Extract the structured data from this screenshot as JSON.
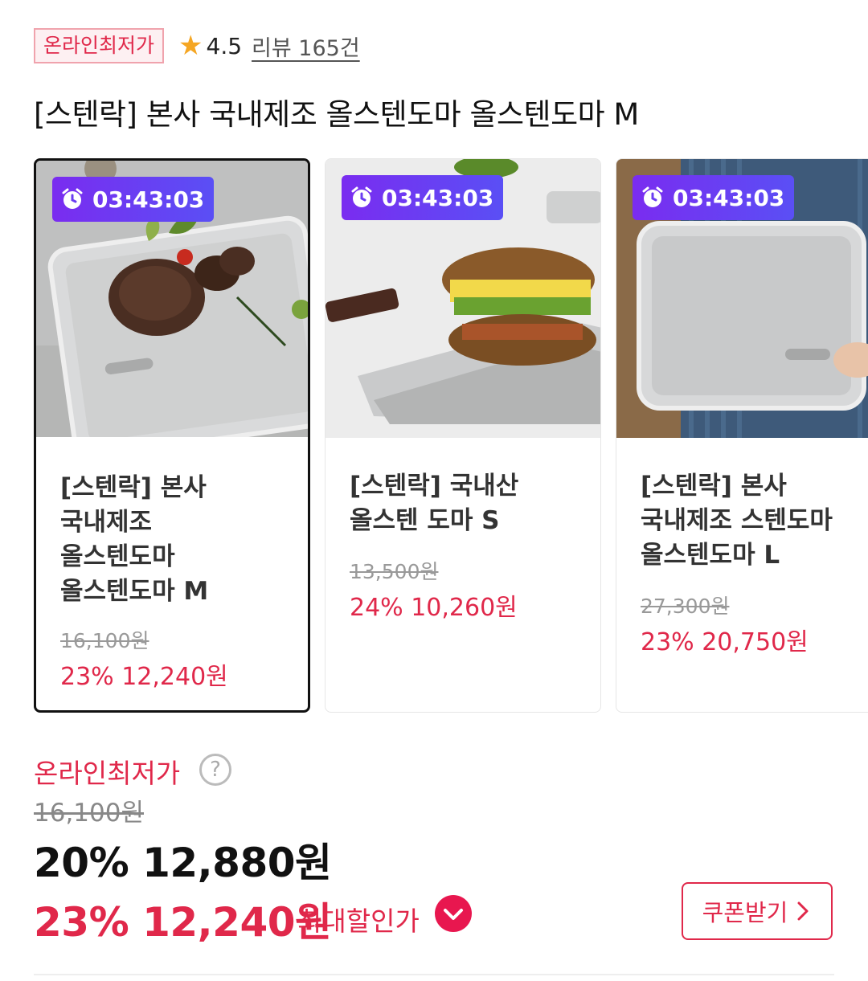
{
  "header": {
    "badge": "온라인최저가",
    "rating": "4.5",
    "review": "리뷰 165건",
    "title": "[스텐락] 본사 국내제조 올스텐도마 올스텐도마 M"
  },
  "cards": [
    {
      "timer": "03:43:03",
      "name_lines": [
        "[스텐락] 본사",
        "국내제조",
        "올스텐도마",
        "올스텐도마 M"
      ],
      "orig": "16,100원",
      "sale": "23% 12,240원"
    },
    {
      "timer": "03:43:03",
      "name_lines": [
        "[스텐락] 국내산",
        "올스텐 도마 S"
      ],
      "orig": "13,500원",
      "sale": "24% 10,260원"
    },
    {
      "timer": "03:43:03",
      "name_lines": [
        "[스텐락] 본사",
        "국내제조 스텐도마",
        "올스텐도마 L"
      ],
      "orig": "27,300원",
      "sale": "23% 20,750원"
    }
  ],
  "price": {
    "label": "온라인최저가",
    "help": "?",
    "orig": "16,100원",
    "current": "20% 12,880원",
    "max": "23% 12,240원",
    "max_label": "최대할인가",
    "coupon": "쿠폰받기"
  },
  "colors": {
    "accent": "#e0284a",
    "timer_start": "#7a2cf0",
    "timer_end": "#5a4ff5"
  }
}
